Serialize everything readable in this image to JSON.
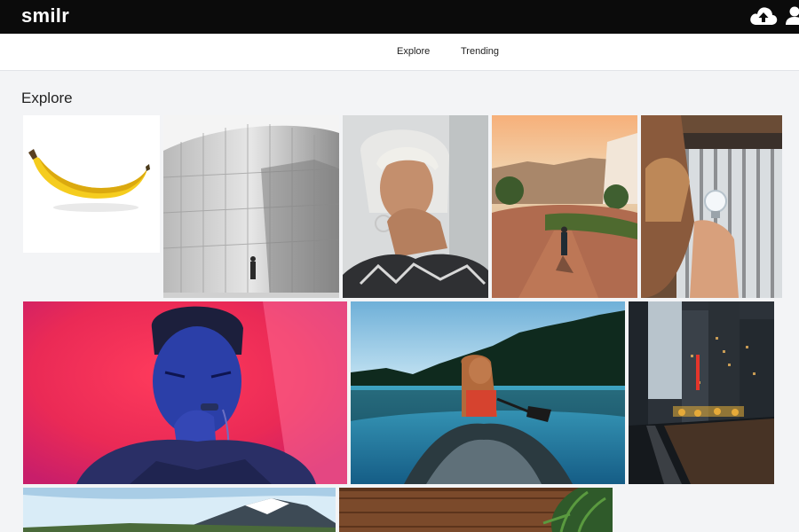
{
  "app": {
    "logo": "smilr"
  },
  "header": {
    "upload_icon": "cloud-upload-icon",
    "user_icon": "user-icon"
  },
  "nav": {
    "items": [
      {
        "label": "Explore"
      },
      {
        "label": "Trending"
      }
    ]
  },
  "main": {
    "title": "Explore"
  },
  "colors": {
    "topbar": "#0b0b0b",
    "background": "#f3f4f6",
    "nav_background": "#ffffff"
  }
}
